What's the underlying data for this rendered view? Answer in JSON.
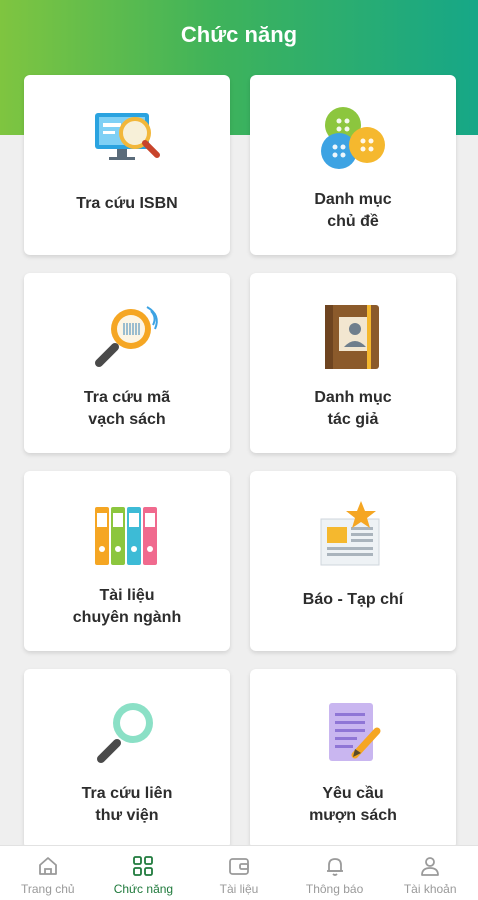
{
  "header": {
    "title": "Chức năng"
  },
  "cards": [
    {
      "label": "Tra cứu ISBN",
      "icon": "computer-search-icon"
    },
    {
      "label": "Danh mục\nchủ đề",
      "icon": "buttons-icon"
    },
    {
      "label": "Tra cứu mã\nvạch sách",
      "icon": "barcode-magnifier-icon"
    },
    {
      "label": "Danh mục\ntác giả",
      "icon": "contact-book-icon"
    },
    {
      "label": "Tài liệu\nchuyên ngành",
      "icon": "binders-icon"
    },
    {
      "label": "Báo - Tạp chí",
      "icon": "newspaper-icon"
    },
    {
      "label": "Tra cứu liên\nthư viện",
      "icon": "magnifier-icon"
    },
    {
      "label": "Yêu cầu\nmượn sách",
      "icon": "document-pen-icon"
    }
  ],
  "nav": [
    {
      "label": "Trang chủ",
      "icon": "home-icon"
    },
    {
      "label": "Chức năng",
      "icon": "grid-icon"
    },
    {
      "label": "Tài liệu",
      "icon": "wallet-icon"
    },
    {
      "label": "Thông báo",
      "icon": "bell-icon"
    },
    {
      "label": "Tài khoản",
      "icon": "user-icon"
    }
  ],
  "colors": {
    "active": "#1f7a3c",
    "inactive": "#9a9a9a",
    "gradient_start": "#7fc540",
    "gradient_end": "#16a787"
  }
}
